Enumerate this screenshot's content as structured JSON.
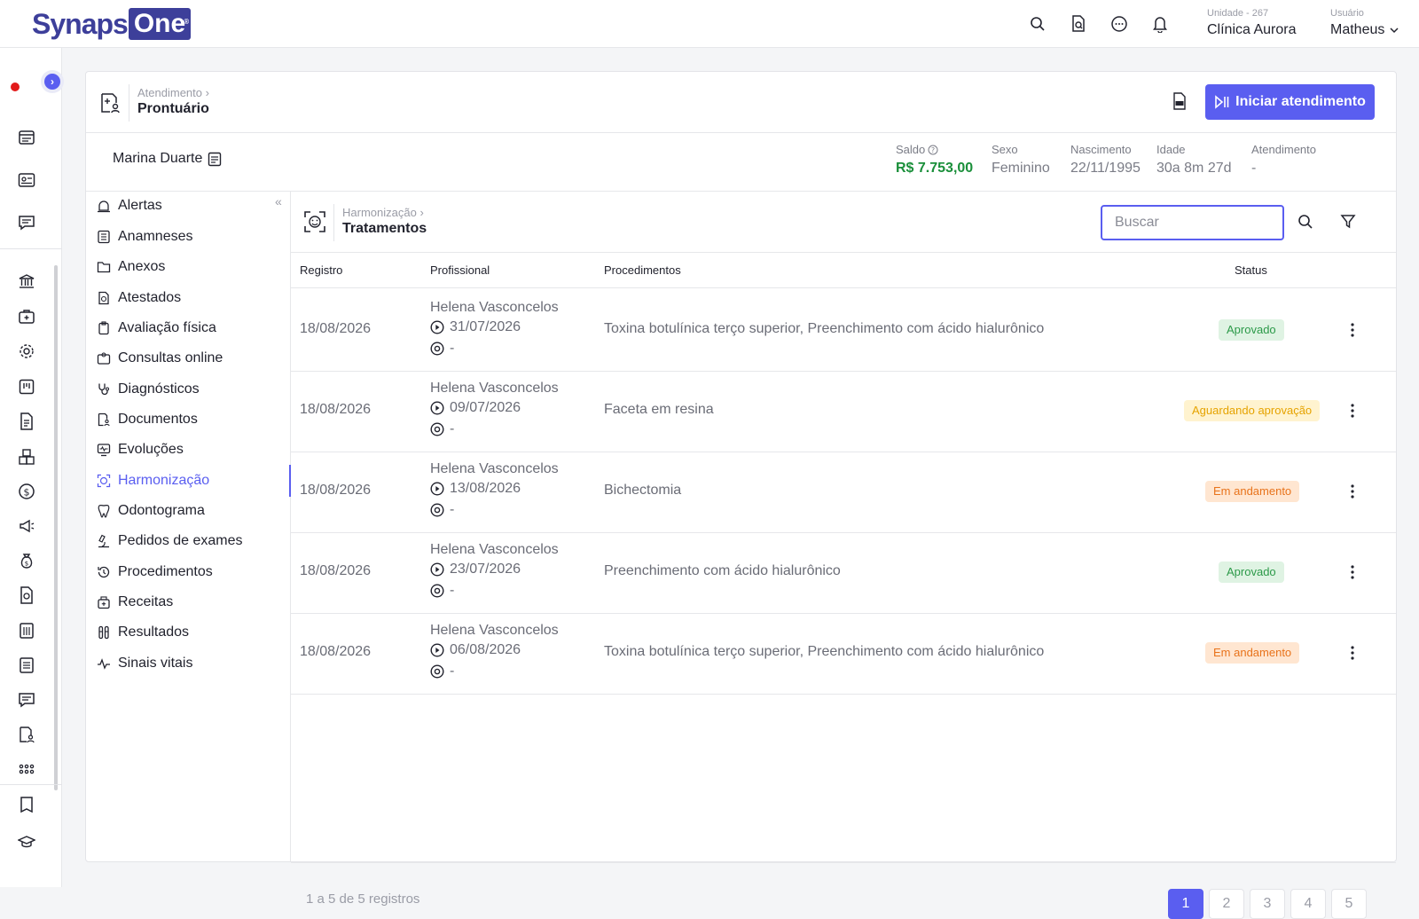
{
  "brand": {
    "part1": "Synaps",
    "part2": "One",
    "reg": "®"
  },
  "topbar": {
    "icons": [
      "search-icon",
      "document-search-icon",
      "chat-icon",
      "bell-icon"
    ],
    "unit_label": "Unidade - 267",
    "unit_value": "Clínica Aurora",
    "user_label": "Usuário",
    "user_value": "Matheus"
  },
  "page_header": {
    "parent": "Atendimento",
    "title": "Prontuário",
    "start_button": "Iniciar atendimento"
  },
  "patient": {
    "name": "Marina Duarte",
    "fields": [
      {
        "label": "Saldo",
        "value": "R$ 7.753,00"
      },
      {
        "label": "Sexo",
        "value": "Feminino"
      },
      {
        "label": "Nascimento",
        "value": "22/11/1995"
      },
      {
        "label": "Idade",
        "value": "30a 8m 27d"
      },
      {
        "label": "Atendimento",
        "value": "-"
      }
    ]
  },
  "menu": [
    {
      "label": "Alertas"
    },
    {
      "label": "Anamneses"
    },
    {
      "label": "Anexos"
    },
    {
      "label": "Atestados"
    },
    {
      "label": "Avaliação física"
    },
    {
      "label": "Consultas online"
    },
    {
      "label": "Diagnósticos"
    },
    {
      "label": "Documentos"
    },
    {
      "label": "Evoluções"
    },
    {
      "label": "Harmonização",
      "active": true
    },
    {
      "label": "Odontograma"
    },
    {
      "label": "Pedidos de exames"
    },
    {
      "label": "Procedimentos"
    },
    {
      "label": "Receitas"
    },
    {
      "label": "Resultados"
    },
    {
      "label": "Sinais vitais"
    }
  ],
  "section": {
    "parent": "Harmonização",
    "title": "Tratamentos",
    "search_placeholder": "Buscar"
  },
  "table": {
    "headers": {
      "registro": "Registro",
      "profissional": "Profissional",
      "procedimentos": "Procedimentos",
      "status": "Status"
    },
    "rows": [
      {
        "registro": "18/08/2026",
        "profissional": "Helena Vasconcelos",
        "inicio": "31/07/2026",
        "fim": "-",
        "procedimentos": "Toxina botulínica terço superior, Preenchimento com ácido hialurônico",
        "status": "Aprovado",
        "status_kind": "ok"
      },
      {
        "registro": "18/08/2026",
        "profissional": "Helena Vasconcelos",
        "inicio": "09/07/2026",
        "fim": "-",
        "procedimentos": "Faceta em resina",
        "status": "Aguardando aprovação",
        "status_kind": "wait"
      },
      {
        "registro": "18/08/2026",
        "profissional": "Helena Vasconcelos",
        "inicio": "13/08/2026",
        "fim": "-",
        "procedimentos": "Bichectomia",
        "status": "Em andamento",
        "status_kind": "prog"
      },
      {
        "registro": "18/08/2026",
        "profissional": "Helena Vasconcelos",
        "inicio": "23/07/2026",
        "fim": "-",
        "procedimentos": "Preenchimento com ácido hialurônico",
        "status": "Aprovado",
        "status_kind": "ok"
      },
      {
        "registro": "18/08/2026",
        "profissional": "Helena Vasconcelos",
        "inicio": "06/08/2026",
        "fim": "-",
        "procedimentos": "Toxina botulínica terço superior, Preenchimento com ácido hialurônico",
        "status": "Em andamento",
        "status_kind": "prog"
      }
    ]
  },
  "pagination": {
    "summary": "1 a 5 de 5 registros",
    "pages": [
      "1",
      "2",
      "3",
      "4",
      "5"
    ],
    "current": "1"
  },
  "colors": {
    "accent": "#5a5ef0",
    "brand": "#3d3f9a",
    "green": "#1a8f3a"
  }
}
